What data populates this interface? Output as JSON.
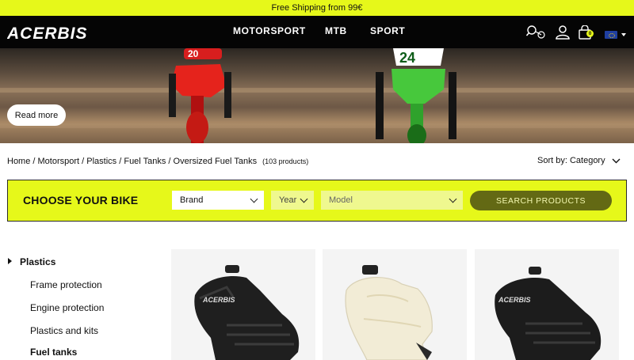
{
  "promo": {
    "text": "Free Shipping from 99€"
  },
  "header": {
    "logo_text": "ACERBIS",
    "nav": [
      "MOTORSPORT",
      "MTB",
      "SPORT"
    ],
    "icons": [
      "bike-search-icon",
      "user-icon",
      "cart-icon",
      "eu-flag-icon"
    ],
    "cart_count": "0"
  },
  "hero": {
    "bike_numbers": [
      "20",
      "24"
    ],
    "read_more": "Read more"
  },
  "breadcrumb": {
    "items": [
      "Home",
      "Motorsport",
      "Plastics",
      "Fuel Tanks",
      "Oversized Fuel Tanks"
    ],
    "count": "(103 products)"
  },
  "sort": {
    "label": "Sort by: Category"
  },
  "bike_selector": {
    "title": "CHOOSE YOUR BIKE",
    "brand": "Brand",
    "year": "Year",
    "model": "Model",
    "search": "SEARCH PRODUCTS"
  },
  "sidebar": {
    "category": "Plastics",
    "items": [
      "Frame protection",
      "Engine protection",
      "Plastics and kits",
      "Fuel tanks"
    ]
  },
  "products": [
    {
      "name": "black-fuel-tank"
    },
    {
      "name": "natural-fuel-tank"
    },
    {
      "name": "black-fuel-tank"
    }
  ],
  "colors": {
    "accent": "#e6f81a",
    "dark": "#050505",
    "button": "#636914"
  }
}
